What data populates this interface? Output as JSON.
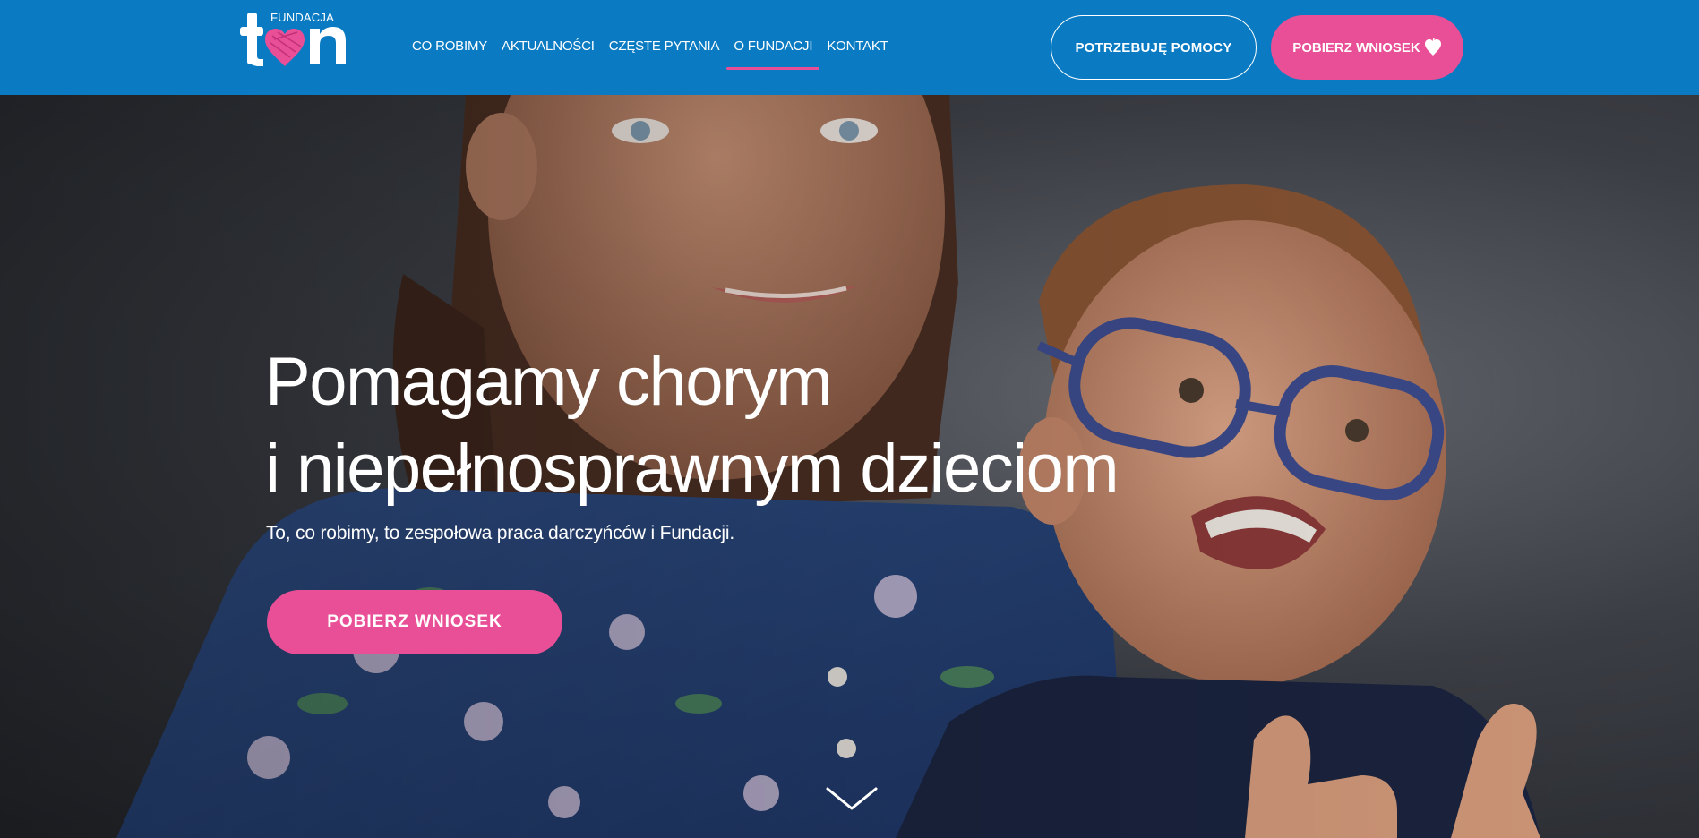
{
  "logo": {
    "top_text": "FUNDACJA",
    "word": "ton",
    "icon": "heart-logo-icon"
  },
  "nav": {
    "items": [
      {
        "label": "CO ROBIMY",
        "active": false
      },
      {
        "label": "AKTUALNOŚCI",
        "active": false
      },
      {
        "label": "CZĘSTE PYTANIA",
        "active": false
      },
      {
        "label": "O FUNDACJI",
        "active": true
      },
      {
        "label": "KONTAKT",
        "active": false
      }
    ]
  },
  "header_buttons": {
    "help_label": "POTRZEBUJĘ POMOCY",
    "download_label": "POBIERZ WNIOSEK",
    "download_icon": "heart-icon"
  },
  "hero": {
    "title_line1": "Pomagamy chorym",
    "title_line2": "i niepełnosprawnym dzieciom",
    "subtitle": "To, co robimy, to zespołowa praca darczyńców i Fundacji.",
    "button_label": "POBIERZ WNIOSEK",
    "scroll_icon": "chevron-down-icon"
  },
  "colors": {
    "header_bg": "#0a7bc2",
    "accent_pink": "#e94f96",
    "text": "#ffffff"
  }
}
